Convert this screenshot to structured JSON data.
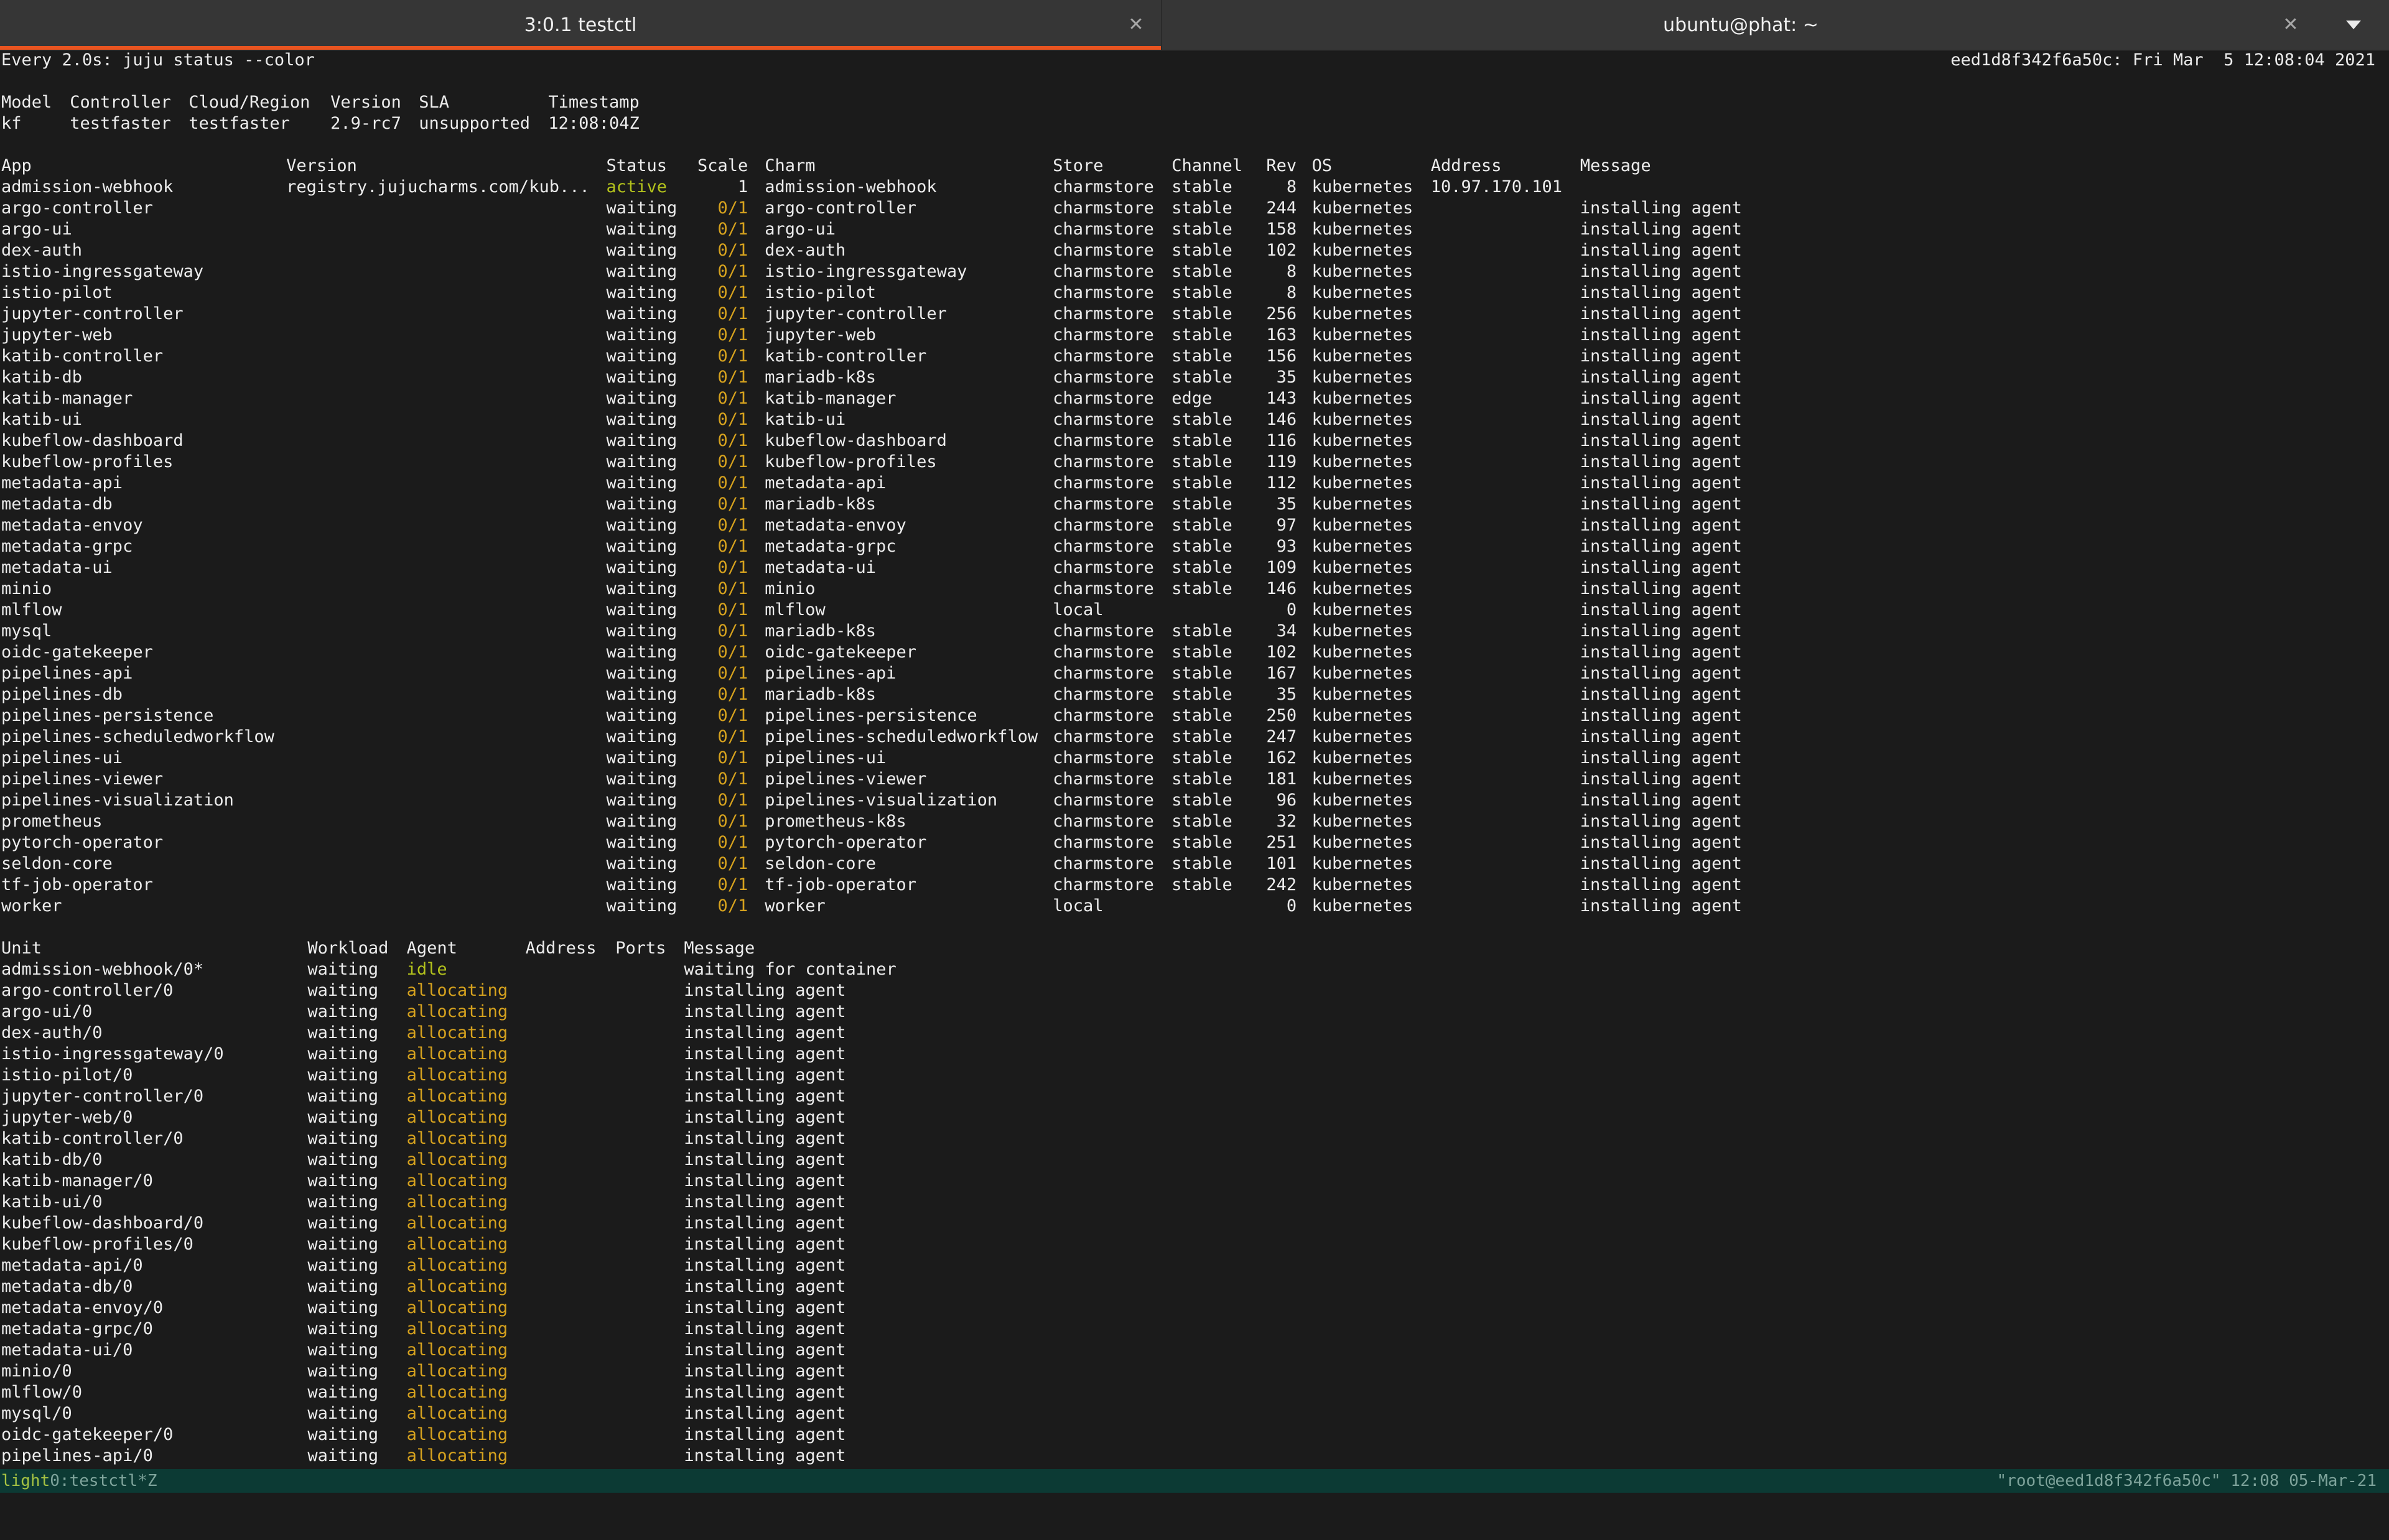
{
  "window": {
    "tabs": [
      {
        "title": "3:0.1 testctl"
      },
      {
        "title": "ubuntu@phat: ~"
      }
    ]
  },
  "terminal": {
    "watch_command": "Every 2.0s: juju status --color",
    "watch_host_time": "eed1d8f342f6a50c: Fri Mar  5 12:08:04 2021",
    "model": {
      "headers": [
        "Model",
        "Controller",
        "Cloud/Region",
        "Version",
        "SLA",
        "Timestamp"
      ],
      "row": [
        "kf",
        "testfaster",
        "testfaster",
        "2.9-rc7",
        "unsupported",
        "12:08:04Z"
      ]
    },
    "apps": {
      "headers": [
        "App",
        "Version",
        "Status",
        "Scale",
        "Charm",
        "Store",
        "Channel",
        "Rev",
        "OS",
        "Address",
        "Message"
      ],
      "rows": [
        [
          "admission-webhook",
          "registry.jujucharms.com/kub...",
          "active",
          "1",
          "admission-webhook",
          "charmstore",
          "stable",
          "8",
          "kubernetes",
          "10.97.170.101",
          ""
        ],
        [
          "argo-controller",
          "",
          "waiting",
          "0/1",
          "argo-controller",
          "charmstore",
          "stable",
          "244",
          "kubernetes",
          "",
          "installing agent"
        ],
        [
          "argo-ui",
          "",
          "waiting",
          "0/1",
          "argo-ui",
          "charmstore",
          "stable",
          "158",
          "kubernetes",
          "",
          "installing agent"
        ],
        [
          "dex-auth",
          "",
          "waiting",
          "0/1",
          "dex-auth",
          "charmstore",
          "stable",
          "102",
          "kubernetes",
          "",
          "installing agent"
        ],
        [
          "istio-ingressgateway",
          "",
          "waiting",
          "0/1",
          "istio-ingressgateway",
          "charmstore",
          "stable",
          "8",
          "kubernetes",
          "",
          "installing agent"
        ],
        [
          "istio-pilot",
          "",
          "waiting",
          "0/1",
          "istio-pilot",
          "charmstore",
          "stable",
          "8",
          "kubernetes",
          "",
          "installing agent"
        ],
        [
          "jupyter-controller",
          "",
          "waiting",
          "0/1",
          "jupyter-controller",
          "charmstore",
          "stable",
          "256",
          "kubernetes",
          "",
          "installing agent"
        ],
        [
          "jupyter-web",
          "",
          "waiting",
          "0/1",
          "jupyter-web",
          "charmstore",
          "stable",
          "163",
          "kubernetes",
          "",
          "installing agent"
        ],
        [
          "katib-controller",
          "",
          "waiting",
          "0/1",
          "katib-controller",
          "charmstore",
          "stable",
          "156",
          "kubernetes",
          "",
          "installing agent"
        ],
        [
          "katib-db",
          "",
          "waiting",
          "0/1",
          "mariadb-k8s",
          "charmstore",
          "stable",
          "35",
          "kubernetes",
          "",
          "installing agent"
        ],
        [
          "katib-manager",
          "",
          "waiting",
          "0/1",
          "katib-manager",
          "charmstore",
          "edge",
          "143",
          "kubernetes",
          "",
          "installing agent"
        ],
        [
          "katib-ui",
          "",
          "waiting",
          "0/1",
          "katib-ui",
          "charmstore",
          "stable",
          "146",
          "kubernetes",
          "",
          "installing agent"
        ],
        [
          "kubeflow-dashboard",
          "",
          "waiting",
          "0/1",
          "kubeflow-dashboard",
          "charmstore",
          "stable",
          "116",
          "kubernetes",
          "",
          "installing agent"
        ],
        [
          "kubeflow-profiles",
          "",
          "waiting",
          "0/1",
          "kubeflow-profiles",
          "charmstore",
          "stable",
          "119",
          "kubernetes",
          "",
          "installing agent"
        ],
        [
          "metadata-api",
          "",
          "waiting",
          "0/1",
          "metadata-api",
          "charmstore",
          "stable",
          "112",
          "kubernetes",
          "",
          "installing agent"
        ],
        [
          "metadata-db",
          "",
          "waiting",
          "0/1",
          "mariadb-k8s",
          "charmstore",
          "stable",
          "35",
          "kubernetes",
          "",
          "installing agent"
        ],
        [
          "metadata-envoy",
          "",
          "waiting",
          "0/1",
          "metadata-envoy",
          "charmstore",
          "stable",
          "97",
          "kubernetes",
          "",
          "installing agent"
        ],
        [
          "metadata-grpc",
          "",
          "waiting",
          "0/1",
          "metadata-grpc",
          "charmstore",
          "stable",
          "93",
          "kubernetes",
          "",
          "installing agent"
        ],
        [
          "metadata-ui",
          "",
          "waiting",
          "0/1",
          "metadata-ui",
          "charmstore",
          "stable",
          "109",
          "kubernetes",
          "",
          "installing agent"
        ],
        [
          "minio",
          "",
          "waiting",
          "0/1",
          "minio",
          "charmstore",
          "stable",
          "146",
          "kubernetes",
          "",
          "installing agent"
        ],
        [
          "mlflow",
          "",
          "waiting",
          "0/1",
          "mlflow",
          "local",
          "",
          "0",
          "kubernetes",
          "",
          "installing agent"
        ],
        [
          "mysql",
          "",
          "waiting",
          "0/1",
          "mariadb-k8s",
          "charmstore",
          "stable",
          "34",
          "kubernetes",
          "",
          "installing agent"
        ],
        [
          "oidc-gatekeeper",
          "",
          "waiting",
          "0/1",
          "oidc-gatekeeper",
          "charmstore",
          "stable",
          "102",
          "kubernetes",
          "",
          "installing agent"
        ],
        [
          "pipelines-api",
          "",
          "waiting",
          "0/1",
          "pipelines-api",
          "charmstore",
          "stable",
          "167",
          "kubernetes",
          "",
          "installing agent"
        ],
        [
          "pipelines-db",
          "",
          "waiting",
          "0/1",
          "mariadb-k8s",
          "charmstore",
          "stable",
          "35",
          "kubernetes",
          "",
          "installing agent"
        ],
        [
          "pipelines-persistence",
          "",
          "waiting",
          "0/1",
          "pipelines-persistence",
          "charmstore",
          "stable",
          "250",
          "kubernetes",
          "",
          "installing agent"
        ],
        [
          "pipelines-scheduledworkflow",
          "",
          "waiting",
          "0/1",
          "pipelines-scheduledworkflow",
          "charmstore",
          "stable",
          "247",
          "kubernetes",
          "",
          "installing agent"
        ],
        [
          "pipelines-ui",
          "",
          "waiting",
          "0/1",
          "pipelines-ui",
          "charmstore",
          "stable",
          "162",
          "kubernetes",
          "",
          "installing agent"
        ],
        [
          "pipelines-viewer",
          "",
          "waiting",
          "0/1",
          "pipelines-viewer",
          "charmstore",
          "stable",
          "181",
          "kubernetes",
          "",
          "installing agent"
        ],
        [
          "pipelines-visualization",
          "",
          "waiting",
          "0/1",
          "pipelines-visualization",
          "charmstore",
          "stable",
          "96",
          "kubernetes",
          "",
          "installing agent"
        ],
        [
          "prometheus",
          "",
          "waiting",
          "0/1",
          "prometheus-k8s",
          "charmstore",
          "stable",
          "32",
          "kubernetes",
          "",
          "installing agent"
        ],
        [
          "pytorch-operator",
          "",
          "waiting",
          "0/1",
          "pytorch-operator",
          "charmstore",
          "stable",
          "251",
          "kubernetes",
          "",
          "installing agent"
        ],
        [
          "seldon-core",
          "",
          "waiting",
          "0/1",
          "seldon-core",
          "charmstore",
          "stable",
          "101",
          "kubernetes",
          "",
          "installing agent"
        ],
        [
          "tf-job-operator",
          "",
          "waiting",
          "0/1",
          "tf-job-operator",
          "charmstore",
          "stable",
          "242",
          "kubernetes",
          "",
          "installing agent"
        ],
        [
          "worker",
          "",
          "waiting",
          "0/1",
          "worker",
          "local",
          "",
          "0",
          "kubernetes",
          "",
          "installing agent"
        ]
      ]
    },
    "units": {
      "headers": [
        "Unit",
        "Workload",
        "Agent",
        "Address",
        "Ports",
        "Message"
      ],
      "rows": [
        [
          "admission-webhook/0*",
          "waiting",
          "idle",
          "",
          "",
          "waiting for container"
        ],
        [
          "argo-controller/0",
          "waiting",
          "allocating",
          "",
          "",
          "installing agent"
        ],
        [
          "argo-ui/0",
          "waiting",
          "allocating",
          "",
          "",
          "installing agent"
        ],
        [
          "dex-auth/0",
          "waiting",
          "allocating",
          "",
          "",
          "installing agent"
        ],
        [
          "istio-ingressgateway/0",
          "waiting",
          "allocating",
          "",
          "",
          "installing agent"
        ],
        [
          "istio-pilot/0",
          "waiting",
          "allocating",
          "",
          "",
          "installing agent"
        ],
        [
          "jupyter-controller/0",
          "waiting",
          "allocating",
          "",
          "",
          "installing agent"
        ],
        [
          "jupyter-web/0",
          "waiting",
          "allocating",
          "",
          "",
          "installing agent"
        ],
        [
          "katib-controller/0",
          "waiting",
          "allocating",
          "",
          "",
          "installing agent"
        ],
        [
          "katib-db/0",
          "waiting",
          "allocating",
          "",
          "",
          "installing agent"
        ],
        [
          "katib-manager/0",
          "waiting",
          "allocating",
          "",
          "",
          "installing agent"
        ],
        [
          "katib-ui/0",
          "waiting",
          "allocating",
          "",
          "",
          "installing agent"
        ],
        [
          "kubeflow-dashboard/0",
          "waiting",
          "allocating",
          "",
          "",
          "installing agent"
        ],
        [
          "kubeflow-profiles/0",
          "waiting",
          "allocating",
          "",
          "",
          "installing agent"
        ],
        [
          "metadata-api/0",
          "waiting",
          "allocating",
          "",
          "",
          "installing agent"
        ],
        [
          "metadata-db/0",
          "waiting",
          "allocating",
          "",
          "",
          "installing agent"
        ],
        [
          "metadata-envoy/0",
          "waiting",
          "allocating",
          "",
          "",
          "installing agent"
        ],
        [
          "metadata-grpc/0",
          "waiting",
          "allocating",
          "",
          "",
          "installing agent"
        ],
        [
          "metadata-ui/0",
          "waiting",
          "allocating",
          "",
          "",
          "installing agent"
        ],
        [
          "minio/0",
          "waiting",
          "allocating",
          "",
          "",
          "installing agent"
        ],
        [
          "mlflow/0",
          "waiting",
          "allocating",
          "",
          "",
          "installing agent"
        ],
        [
          "mysql/0",
          "waiting",
          "allocating",
          "",
          "",
          "installing agent"
        ],
        [
          "oidc-gatekeeper/0",
          "waiting",
          "allocating",
          "",
          "",
          "installing agent"
        ],
        [
          "pipelines-api/0",
          "waiting",
          "allocating",
          "",
          "",
          "installing agent"
        ]
      ]
    }
  },
  "tmux": {
    "session": "light",
    "window": "0:testctl*Z",
    "right": "\"root@eed1d8f342f6a50c\" 12:08 05-Mar-21"
  },
  "colors": {
    "status_active": "#b3c21c",
    "status_warn": "#d6a21e",
    "tab_indicator": "#e95420",
    "statusbar_bg": "#0c3a34"
  }
}
